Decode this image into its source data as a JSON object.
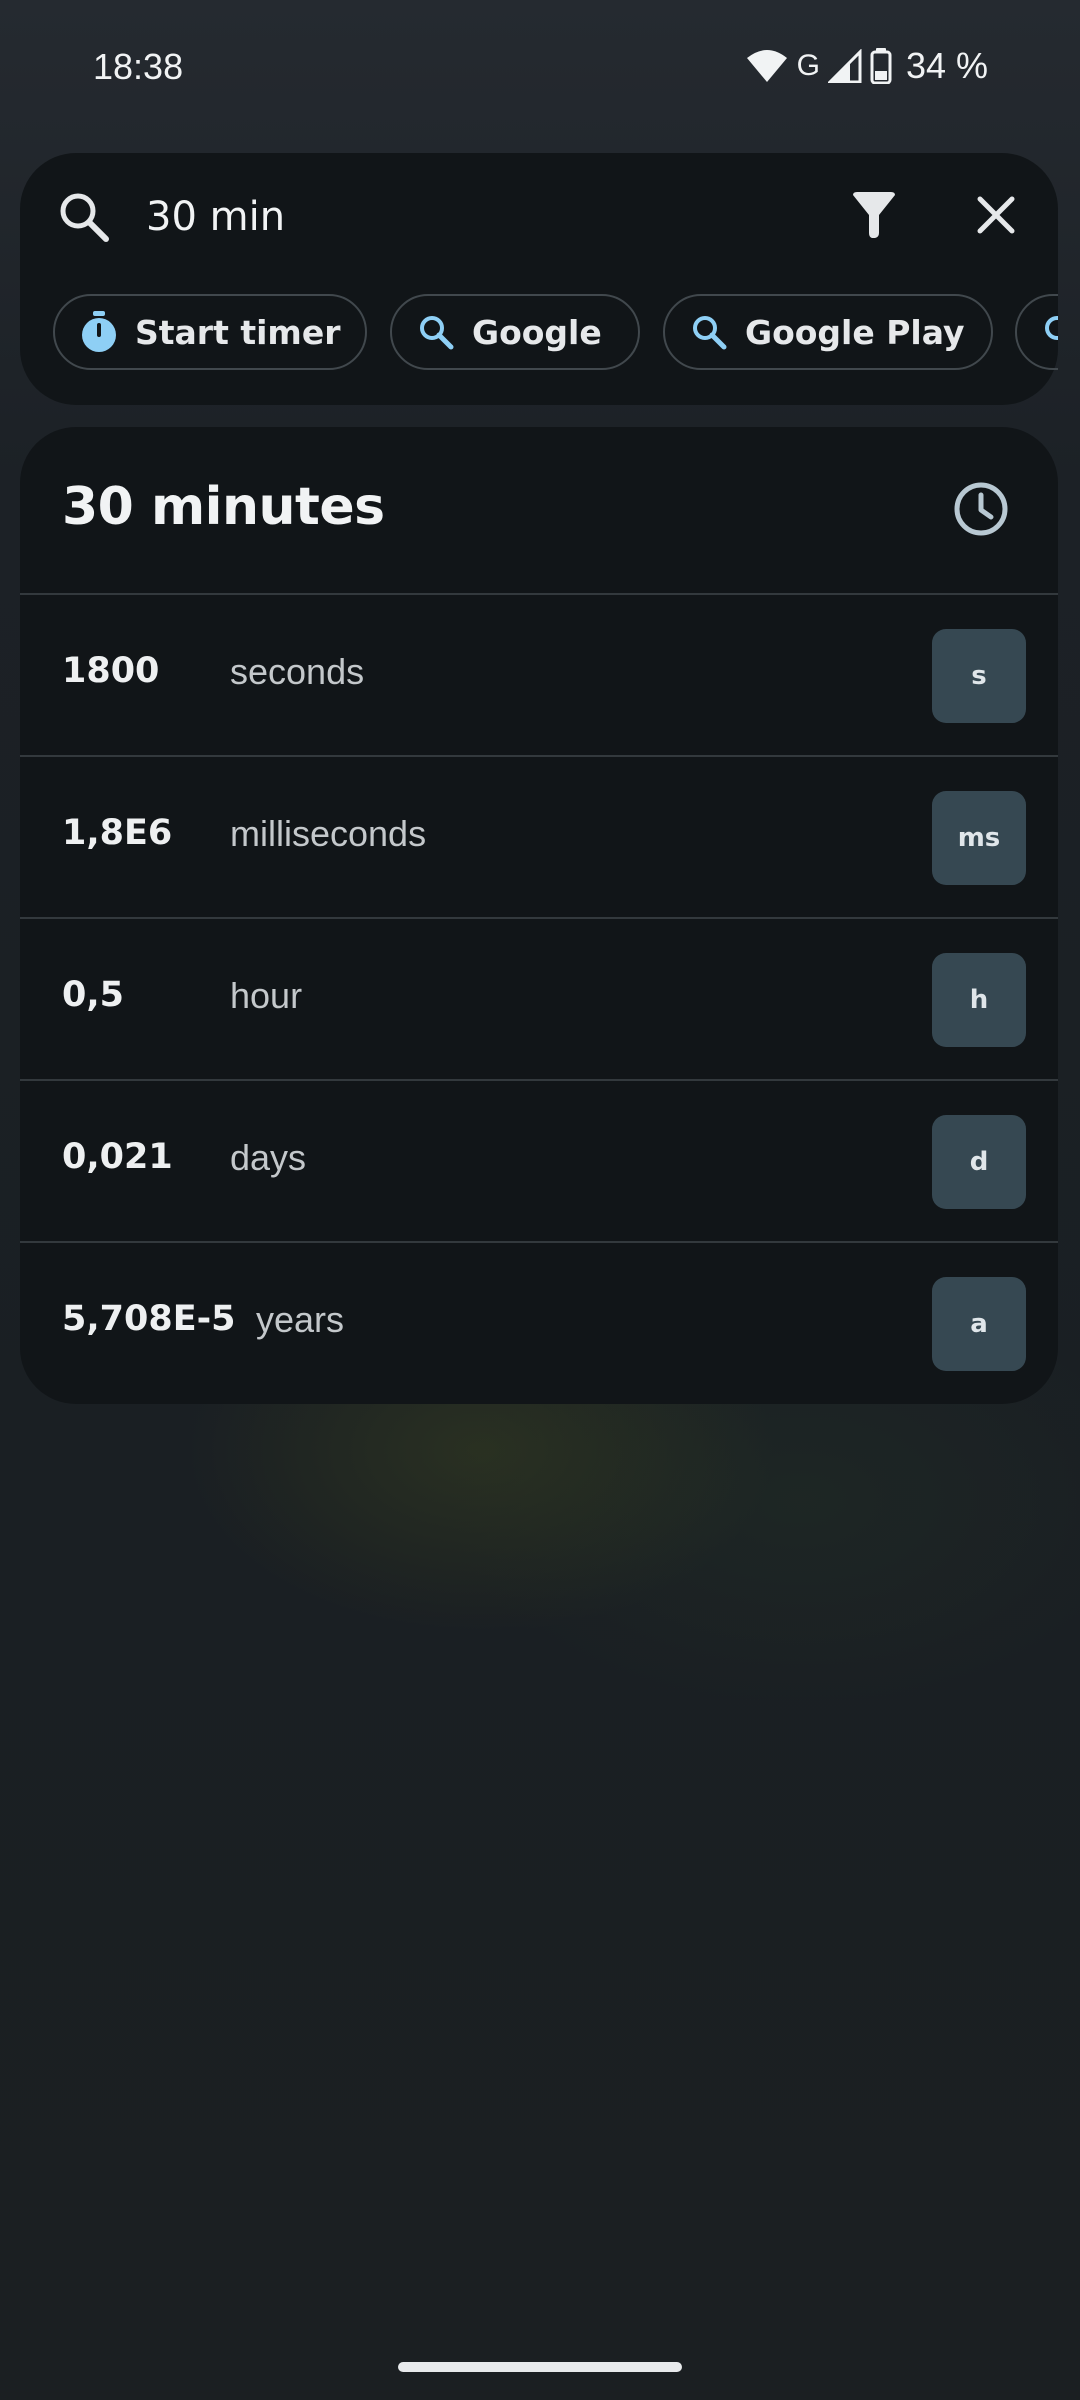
{
  "status_bar": {
    "time": "18:38",
    "network_type": "G",
    "battery": "34 %"
  },
  "search": {
    "query": "30 min"
  },
  "chips": [
    {
      "label": "Start timer",
      "icon": "timer-icon"
    },
    {
      "label": "Google",
      "icon": "search-icon"
    },
    {
      "label": "Google Play",
      "icon": "search-icon"
    }
  ],
  "result": {
    "title": "30 minutes",
    "rows": [
      {
        "value": "1800",
        "unit": "seconds",
        "symbol": "s"
      },
      {
        "value": "1,8E6",
        "unit": "milliseconds",
        "symbol": "ms"
      },
      {
        "value": "0,5",
        "unit": "hour",
        "symbol": "h"
      },
      {
        "value": "0,021",
        "unit": "days",
        "symbol": "d"
      },
      {
        "value": "5,708E-5",
        "unit": "years",
        "symbol": "a"
      }
    ]
  },
  "colors": {
    "accent": "#8ecff5",
    "card": "#111518",
    "badge": "#364852"
  }
}
